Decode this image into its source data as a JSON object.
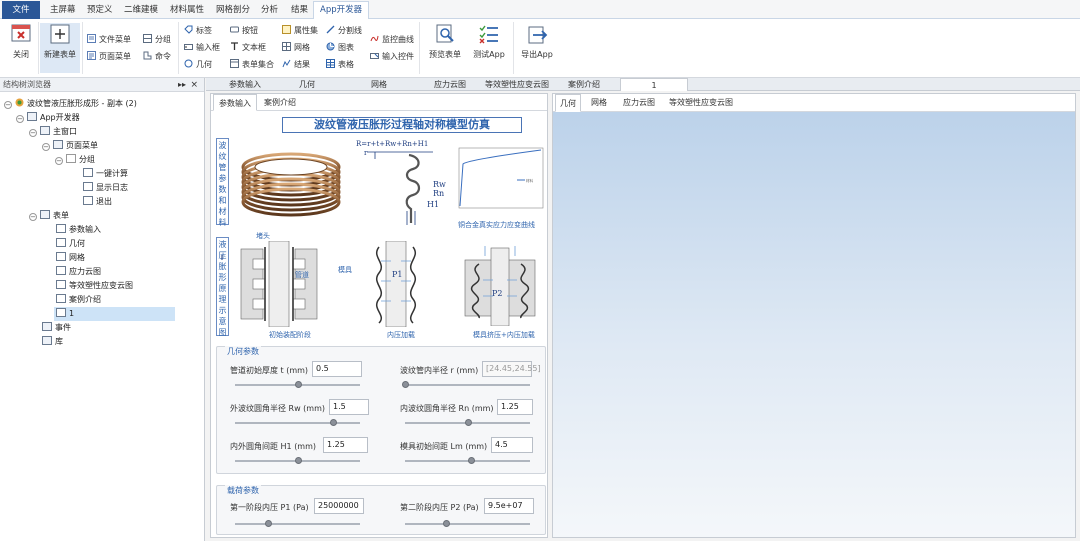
{
  "menu": {
    "file": "文件",
    "items": [
      "主屏幕",
      "预定义",
      "二维建模",
      "材料属性",
      "网格剖分",
      "分析",
      "结果"
    ],
    "active": "App开发器"
  },
  "ribbon": {
    "close": "关闭",
    "new_form": "新建表单",
    "file_menu": "文件菜单",
    "page_menu": "页面菜单",
    "group": "分组",
    "command": "命令",
    "label": "标签",
    "input_box": "输入框",
    "geometry": "几何",
    "button": "按钮",
    "text_box": "文本框",
    "form_set": "表单集合",
    "attr_set": "属性集",
    "mesh": "网格",
    "result": "结果",
    "divider": "分割线",
    "chart": "图表",
    "table": "表格",
    "monitor_curve": "监控曲线",
    "input_control": "输入控件",
    "preview_form": "预览表单",
    "test_app": "测试App",
    "export_app": "导出App"
  },
  "tree": {
    "panel_title": "结构树浏览器",
    "pin_glyph": "▸▸",
    "close_glyph": "×",
    "expanded_glyph": "−",
    "rows": [
      {
        "label": "波纹管液压胀形成形 - 副本 (2)"
      },
      {
        "label": "App开发器"
      },
      {
        "label": "主窗口"
      },
      {
        "label": "页面菜单"
      },
      {
        "label": "分组"
      },
      {
        "label": "一键计算"
      },
      {
        "label": "显示日志"
      },
      {
        "label": "退出"
      },
      {
        "label": "表单"
      },
      {
        "label": "参数输入"
      },
      {
        "label": "几何"
      },
      {
        "label": "网格"
      },
      {
        "label": "应力云图"
      },
      {
        "label": "等效塑性应变云图"
      },
      {
        "label": "案例介绍"
      },
      {
        "label": "1"
      },
      {
        "label": "事件"
      },
      {
        "label": "库"
      }
    ]
  },
  "doc_tabs": [
    "参数输入",
    "几何",
    "网格",
    "应力云图",
    "等效塑性应变云图",
    "案例介绍",
    "1"
  ],
  "form": {
    "tabs": [
      "参数输入",
      "案例介绍"
    ],
    "title": "波纹管液压胀形过程轴对称模型仿真",
    "side_label_1": "波纹管参数和材料",
    "side_label_2": "液压胀形原理示意图",
    "formula": "R=r+t+Rw+Rn+H1",
    "label_rw": "Rw",
    "label_rn": "Rn",
    "label_h1": "H1",
    "label_r": "r",
    "curve_caption": "铜合金真实应力应变曲线",
    "legend_text": "材料",
    "plug_label": "堵头",
    "pipe_label": "管道",
    "die_label": "模具",
    "p1_label": "P1",
    "p2_label": "P2",
    "stage1": "初始装配阶段",
    "stage2": "内压加载",
    "stage3": "模具挤压+内压加载",
    "geom_group": "几何参数",
    "load_group": "载荷参数",
    "fields": {
      "t_label": "管道初始厚度 t (mm)",
      "t_value": "0.5",
      "r_label": "波纹管内半径 r (mm)",
      "r_value": "[24.45,24.55]",
      "rw_label": "外波纹圆角半径 Rw (mm)",
      "rw_value": "1.5",
      "rn_label": "内波纹圆角半径 Rn (mm)",
      "rn_value": "1.25",
      "h1_label": "内外圆角间距 H1 (mm)",
      "h1_value": "1.25",
      "lm_label": "模具初始间距 Lm (mm)",
      "lm_value": "4.5",
      "p1_label": "第一阶段内压 P1 (Pa)",
      "p1_value": "25000000",
      "p2_label": "第二阶段内压 P2 (Pa)",
      "p2_value": "9.5e+07"
    }
  },
  "view": {
    "tabs": [
      "几何",
      "网格",
      "应力云图",
      "等效塑性应变云图"
    ]
  }
}
